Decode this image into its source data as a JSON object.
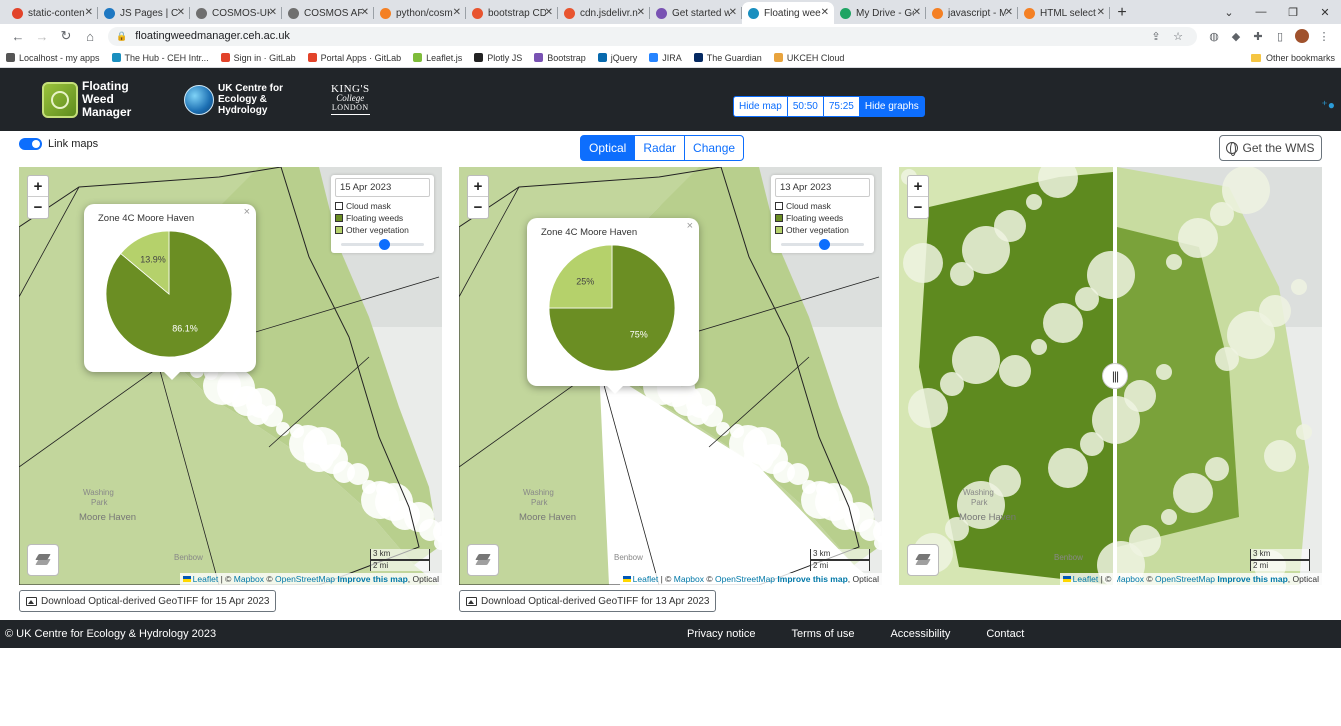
{
  "browser": {
    "tabs": [
      {
        "label": "static-conten",
        "color": "#e2432a"
      },
      {
        "label": "JS Pages | CE",
        "color": "#1e78c2"
      },
      {
        "label": "COSMOS-UK",
        "color": "#6f6f6f"
      },
      {
        "label": "COSMOS API",
        "color": "#6f6f6f"
      },
      {
        "label": "python/cosm",
        "color": "#f48024"
      },
      {
        "label": "bootstrap CD",
        "color": "#e8542f"
      },
      {
        "label": "cdn.jsdelivr.n",
        "color": "#e8542f"
      },
      {
        "label": "Get started w",
        "color": "#7952b3"
      },
      {
        "label": "Floating wee",
        "color": "#1a8fbf",
        "active": true
      },
      {
        "label": "My Drive - Go",
        "color": "#1fa463"
      },
      {
        "label": "javascript - M",
        "color": "#f48024"
      },
      {
        "label": "HTML select",
        "color": "#f48024"
      }
    ],
    "url": "floatingweedmanager.ceh.ac.uk",
    "bookmarks": [
      {
        "label": "Localhost - my apps",
        "color": "#555"
      },
      {
        "label": "The Hub - CEH Intr...",
        "color": "#1a8fbf"
      },
      {
        "label": "Sign in · GitLab",
        "color": "#e2432a"
      },
      {
        "label": "Portal Apps · GitLab",
        "color": "#e2432a"
      },
      {
        "label": "Leaflet.js",
        "color": "#7ebc3a"
      },
      {
        "label": "Plotly JS",
        "color": "#222"
      },
      {
        "label": "Bootstrap",
        "color": "#7952b3"
      },
      {
        "label": "jQuery",
        "color": "#0769ad"
      },
      {
        "label": "JIRA",
        "color": "#2684ff"
      },
      {
        "label": "The Guardian",
        "color": "#052962"
      },
      {
        "label": "UKCEH Cloud",
        "color": "#e8a33d"
      }
    ],
    "other_bookmarks": "Other bookmarks"
  },
  "header": {
    "app_name_line1": "Floating Weed",
    "app_name_line2": "Manager",
    "ceh_line1": "UK Centre for",
    "ceh_line2": "Ecology & Hydrology",
    "kcl_line1": "KING'S",
    "kcl_line2": "College",
    "kcl_line3": "LONDON",
    "view_buttons": [
      "Hide map",
      "50:50",
      "75:25",
      "Hide graphs"
    ],
    "active_view": "Hide graphs"
  },
  "controls": {
    "link_maps_label": "Link maps",
    "link_maps_on": true,
    "modes": [
      "Optical",
      "Radar",
      "Change"
    ],
    "active_mode": "Optical",
    "wms_label": "Get the WMS"
  },
  "legend": {
    "items": [
      {
        "label": "Cloud mask",
        "color": "#ffffff"
      },
      {
        "label": "Floating weeds",
        "color": "#6b8e23"
      },
      {
        "label": "Other vegetation",
        "color": "#b5d16b"
      }
    ]
  },
  "maps": [
    {
      "date": "15 Apr 2023",
      "popup": {
        "title": "Zone 4C Moore Haven",
        "slices": [
          {
            "label": "86.1%",
            "value": 86.1,
            "color": "#6b8e23"
          },
          {
            "label": "13.9%",
            "value": 13.9,
            "color": "#b5d16b"
          }
        ]
      },
      "download": "Download Optical-derived GeoTIFF for 15 Apr 2023"
    },
    {
      "date": "13 Apr 2023",
      "popup": {
        "title": "Zone 4C Moore Haven",
        "slices": [
          {
            "label": "75%",
            "value": 75,
            "color": "#6b8e23"
          },
          {
            "label": "25%",
            "value": 25,
            "color": "#b5d16b"
          }
        ]
      },
      "download": "Download Optical-derived GeoTIFF for 13 Apr 2023"
    },
    {}
  ],
  "map_common": {
    "place_labels": [
      "Moore Haven",
      "Washing",
      "Park",
      "Benbow"
    ],
    "scale_km": "3 km",
    "scale_mi": "2 mi",
    "attrib_leaflet": "Leaflet",
    "attrib_mapbox": "Mapbox",
    "attrib_osm": "OpenStreetMap",
    "attrib_improve": "Improve this map",
    "attrib_suffix": "Optical",
    "swipe_glyph": "|||"
  },
  "footer": {
    "copyright": "© UK Centre for Ecology & Hydrology 2023",
    "links": [
      "Privacy notice",
      "Terms of use",
      "Accessibility",
      "Contact"
    ]
  }
}
